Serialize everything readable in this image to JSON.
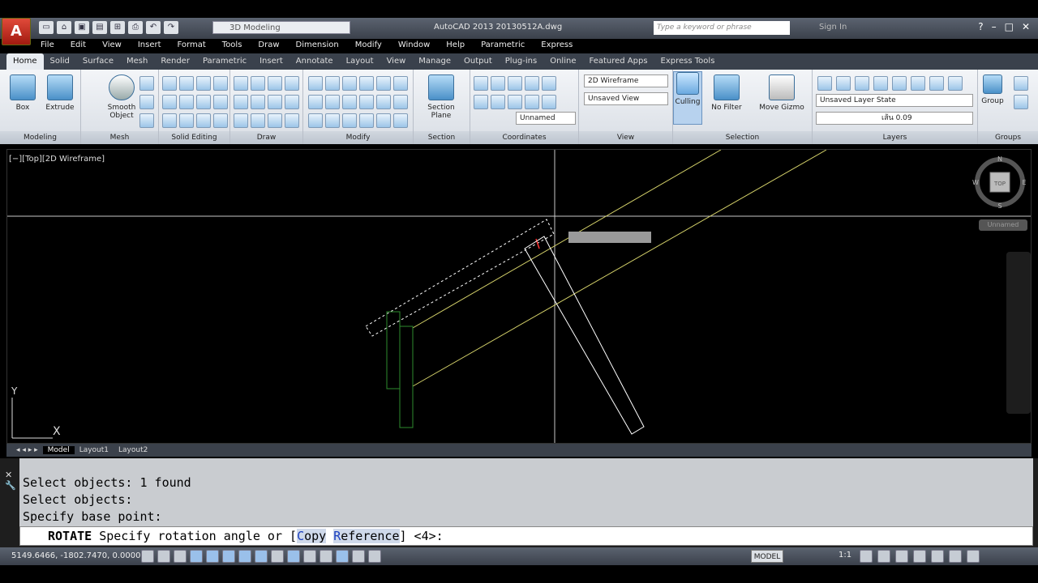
{
  "window": {
    "title": "AutoCAD 2013   20130512A.dwg",
    "workspace": "3D Modeling",
    "search_placeholder": "Type a keyword or phrase",
    "sign_in": "Sign In"
  },
  "menu": [
    "File",
    "Edit",
    "View",
    "Insert",
    "Format",
    "Tools",
    "Draw",
    "Dimension",
    "Modify",
    "Window",
    "Help",
    "Parametric",
    "Express"
  ],
  "ribbon_tabs": [
    "Home",
    "Solid",
    "Surface",
    "Mesh",
    "Render",
    "Parametric",
    "Insert",
    "Annotate",
    "Layout",
    "View",
    "Manage",
    "Output",
    "Plug-ins",
    "Online",
    "Featured Apps",
    "Express Tools"
  ],
  "ribbon": {
    "box": "Box",
    "extrude": "Extrude",
    "smooth_object": "Smooth Object",
    "section_plane": "Section Plane",
    "culling": "Culling",
    "no_filter": "No Filter",
    "move_gizmo": "Move Gizmo",
    "group": "Group",
    "visual_style": "2D Wireframe",
    "view_state": "Unsaved View",
    "ucs": "Unnamed",
    "layer_state": "Unsaved Layer State",
    "layer": "เส้น 0.09",
    "panels": [
      "Modeling",
      "Mesh",
      "Solid Editing",
      "Draw",
      "Modify",
      "Section",
      "Coordinates",
      "View",
      "Selection",
      "Layers",
      "Groups"
    ]
  },
  "viewport": {
    "label": "[−][Top][2D Wireframe]",
    "cube_top": "TOP",
    "cube_n": "N",
    "cube_s": "S",
    "cube_w": "W",
    "cube_e": "E",
    "ucs_y": "Y",
    "ucs_x": "X",
    "cube_state": "Unnamed"
  },
  "layout_tabs": [
    "Model",
    "Layout1",
    "Layout2"
  ],
  "command": {
    "history": [
      "Select objects: 1 found",
      "Select objects:",
      "Specify base point:"
    ],
    "name": "ROTATE",
    "prompt": "Specify rotation angle or [",
    "opt_copy_key": "C",
    "opt_copy_rest": "opy",
    "opt_ref_key": "R",
    "opt_ref_rest": "eference",
    "suffix": "] <4>:"
  },
  "status": {
    "coords": "5149.6466, -1802.7470, 0.0000",
    "model": "MODEL",
    "scale": "1:1"
  },
  "colors": {
    "accent": "#4a90c8",
    "drawing_yellow": "#d5d26a",
    "drawing_green": "#2e8b2e",
    "crosshair": "#c8c8c8",
    "selection_red": "#ff3333"
  }
}
